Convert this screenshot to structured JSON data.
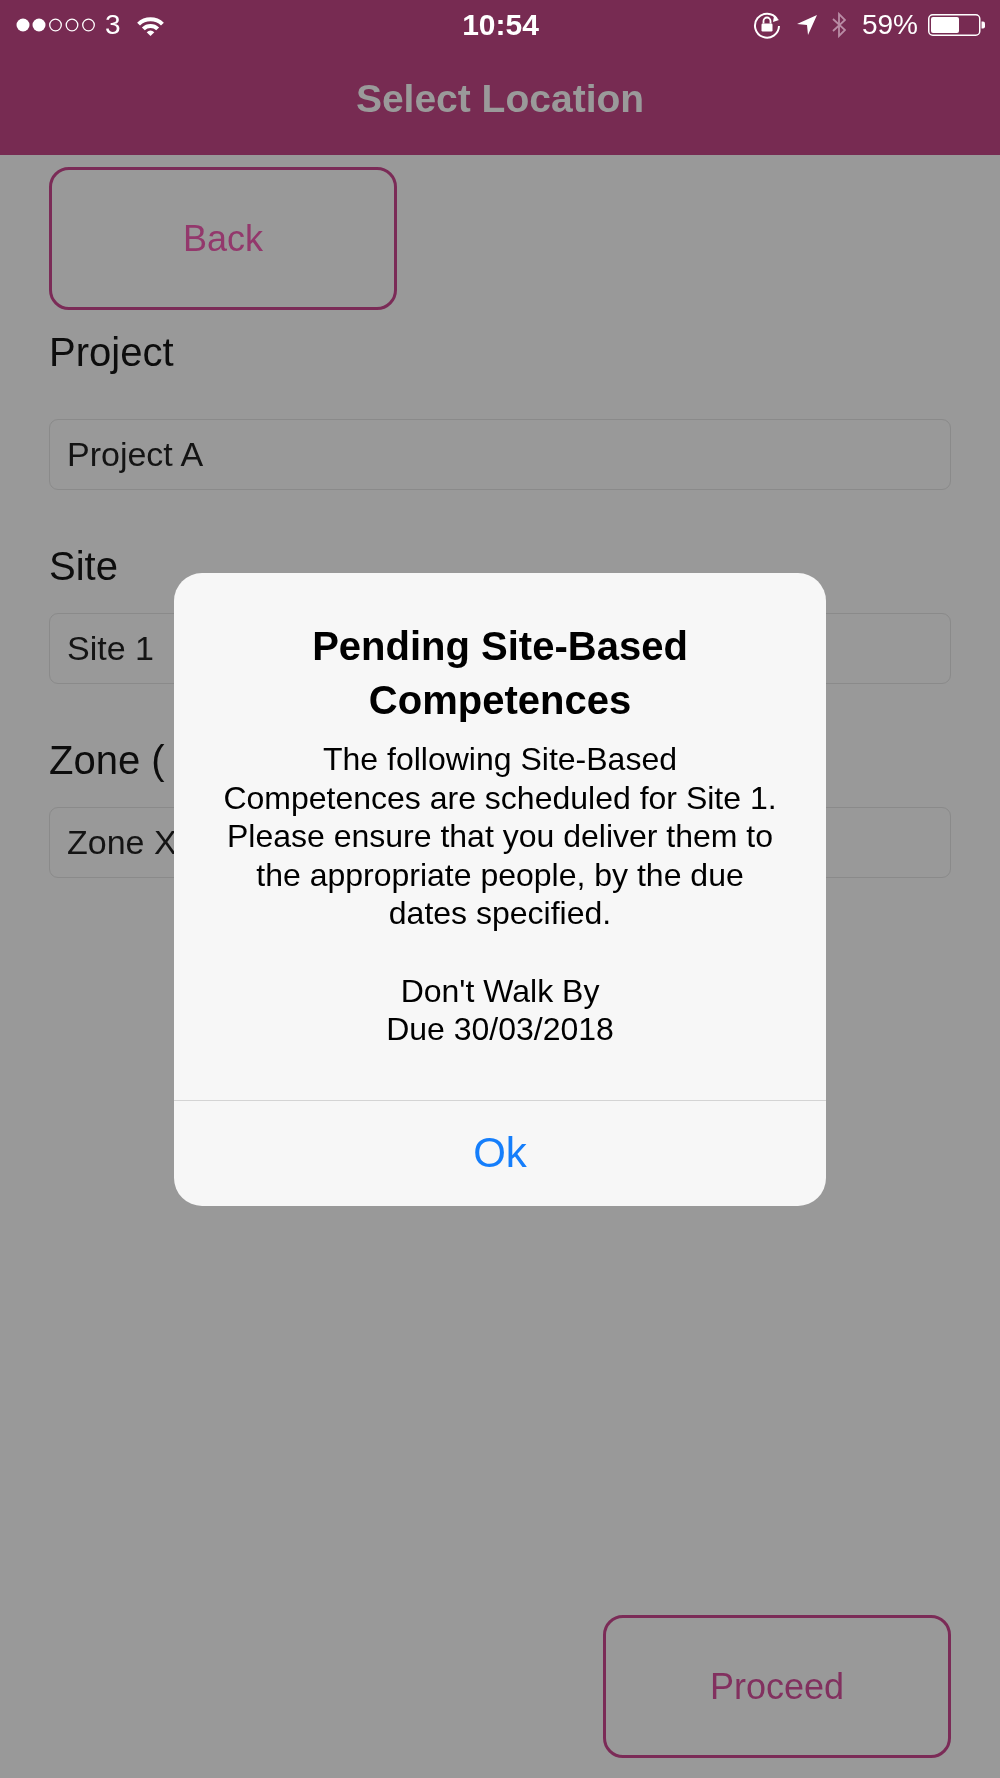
{
  "status_bar": {
    "carrier": "3",
    "time": "10:54",
    "battery": "59%"
  },
  "nav_bar": {
    "title": "Select Location"
  },
  "back_button": {
    "label": "Back"
  },
  "fields": [
    {
      "label": "Project",
      "value": "Project A"
    },
    {
      "label": "Site",
      "value": "Site 1"
    },
    {
      "label": "Zone (",
      "value": "Zone X"
    }
  ],
  "proceed_button": {
    "label": "Proceed"
  },
  "alert": {
    "title": "Pending Site-Based Competences",
    "message": "The following Site-Based Competences are scheduled for Site 1. Please ensure that you deliver them to the appropriate people, by the due dates specified.",
    "competences": [
      {
        "name": "Don't Walk By",
        "due": "Due 30/03/2018"
      }
    ],
    "buttons": [
      {
        "label": "Ok"
      }
    ]
  }
}
